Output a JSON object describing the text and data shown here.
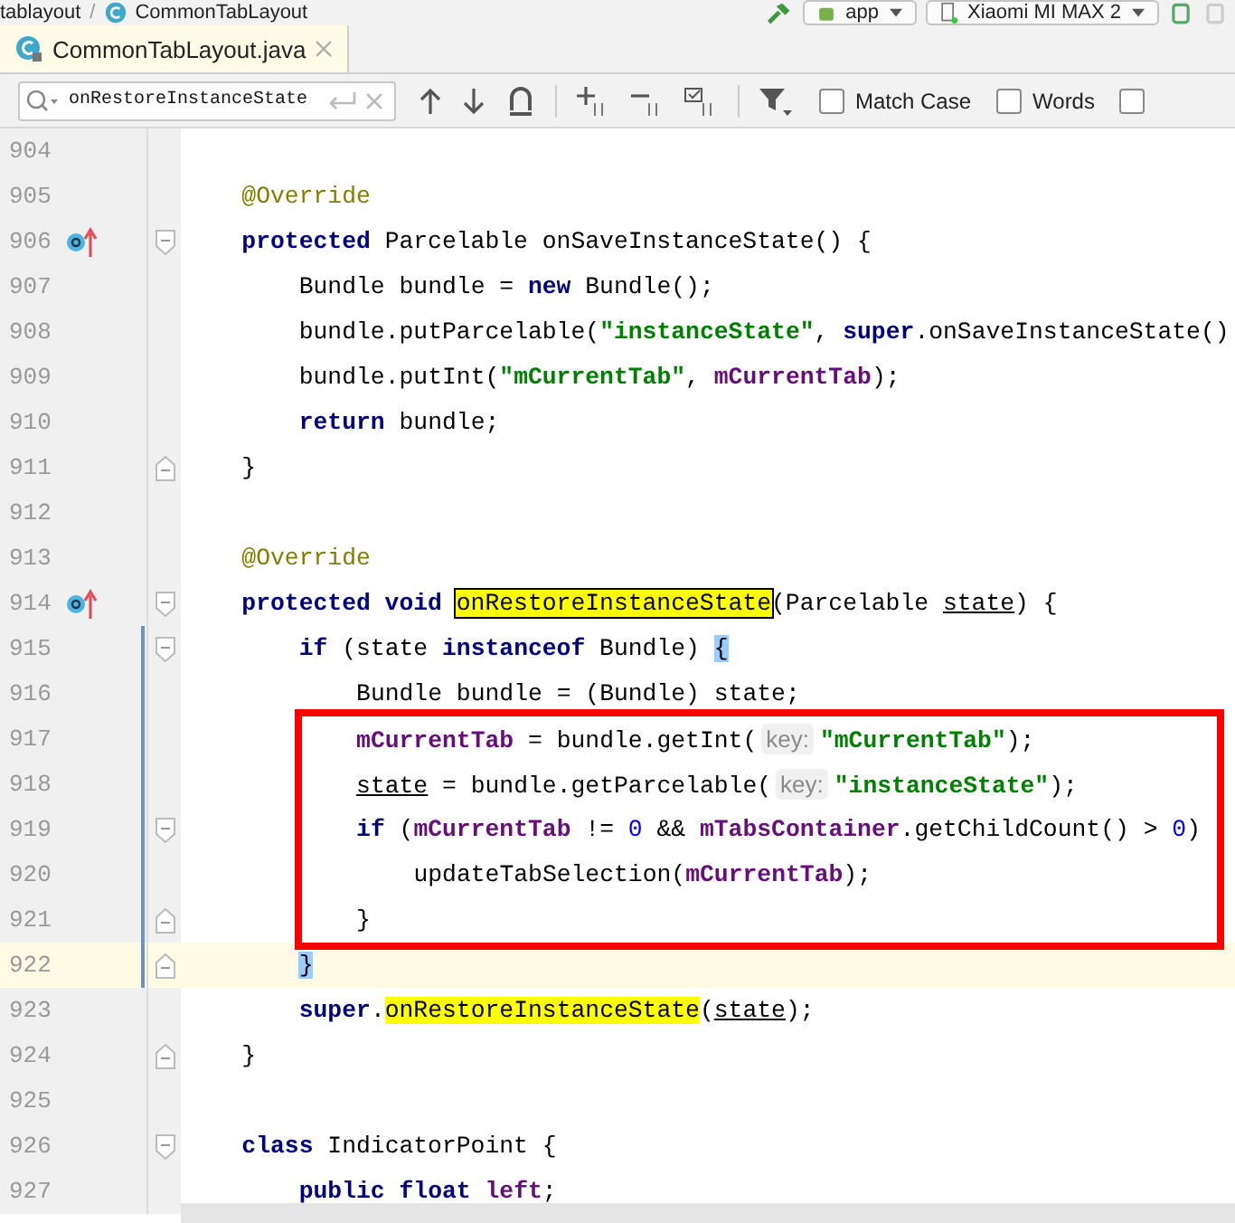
{
  "breadcrumbs": [
    {
      "label": "tablayout"
    },
    {
      "label": "CommonTabLayout"
    }
  ],
  "breadcrumb_separator": "/",
  "toolbar": {
    "run_config": "app",
    "device": "Xiaomi MI MAX 2"
  },
  "tabs": [
    {
      "label": "CommonTabLayout.java",
      "selected": true
    }
  ],
  "search": {
    "value": "onRestoreInstanceState",
    "options": [
      {
        "label": "Match Case",
        "checked": false
      },
      {
        "label": "Words",
        "checked": false
      },
      {
        "checked": false
      }
    ]
  },
  "lines": [
    {
      "number": "904",
      "override": false,
      "changed": false,
      "current": false,
      "boxed": false,
      "fold_start": false,
      "fold_end": false
    },
    {
      "number": "905",
      "override": false,
      "changed": false,
      "current": false,
      "boxed": false,
      "fold_start": false,
      "fold_end": false,
      "tokens": [
        {
          "kind": "ann",
          "text": "@Override"
        }
      ]
    },
    {
      "number": "906",
      "override": true,
      "changed": false,
      "current": false,
      "boxed": false,
      "fold_start": true,
      "fold_end": false,
      "tokens": [
        {
          "kind": "kw",
          "text": "protected"
        },
        {
          "kind": "plain",
          "text": " Parcelable onSaveInstanceState() {"
        }
      ],
      "children": [
        {
          "number": "907",
          "override": false,
          "changed": false,
          "current": false,
          "boxed": false,
          "fold_start": false,
          "fold_end": false,
          "tokens": [
            {
              "kind": "plain",
              "text": "Bundle bundle = "
            },
            {
              "kind": "kw",
              "text": "new"
            },
            {
              "kind": "plain",
              "text": " Bundle();"
            }
          ]
        },
        {
          "number": "908",
          "override": false,
          "changed": false,
          "current": false,
          "boxed": false,
          "fold_start": false,
          "fold_end": false,
          "tokens": [
            {
              "kind": "plain",
              "text": "bundle.putParcelable("
            },
            {
              "kind": "str",
              "text": "\"instanceState\""
            },
            {
              "kind": "plain",
              "text": ", "
            },
            {
              "kind": "kw",
              "text": "super"
            },
            {
              "kind": "plain",
              "text": ".onSaveInstanceState()"
            }
          ]
        },
        {
          "number": "909",
          "override": false,
          "changed": false,
          "current": false,
          "boxed": false,
          "fold_start": false,
          "fold_end": false,
          "tokens": [
            {
              "kind": "plain",
              "text": "bundle.putInt("
            },
            {
              "kind": "str",
              "text": "\"mCurrentTab\""
            },
            {
              "kind": "plain",
              "text": ", "
            },
            {
              "kind": "field",
              "text": "mCurrentTab"
            },
            {
              "kind": "plain",
              "text": ");"
            }
          ]
        },
        {
          "number": "910",
          "override": false,
          "changed": false,
          "current": false,
          "boxed": false,
          "fold_start": false,
          "fold_end": false,
          "tokens": [
            {
              "kind": "kw",
              "text": "return"
            },
            {
              "kind": "plain",
              "text": " bundle;"
            }
          ]
        }
      ]
    },
    {
      "number": "911",
      "override": false,
      "changed": false,
      "current": false,
      "boxed": false,
      "fold_start": false,
      "fold_end": true,
      "tokens": [
        {
          "kind": "plain",
          "text": "}"
        }
      ]
    },
    {
      "number": "912",
      "override": false,
      "changed": false,
      "current": false,
      "boxed": false,
      "fold_start": false,
      "fold_end": false
    },
    {
      "number": "913",
      "override": false,
      "changed": false,
      "current": false,
      "boxed": false,
      "fold_start": false,
      "fold_end": false,
      "tokens": [
        {
          "kind": "ann",
          "text": "@Override"
        }
      ]
    },
    {
      "number": "914",
      "override": true,
      "changed": false,
      "current": false,
      "boxed": false,
      "fold_start": true,
      "fold_end": false,
      "tokens": [
        {
          "kind": "kw",
          "text": "protected void "
        },
        {
          "kind": "match-current",
          "text": "onRestoreInstanceState"
        },
        {
          "kind": "plain",
          "text": "(Parcelable "
        },
        {
          "kind": "param",
          "text": "state"
        },
        {
          "kind": "plain",
          "text": ") {"
        }
      ],
      "children": [
        {
          "number": "915",
          "override": false,
          "changed": true,
          "current": false,
          "boxed": false,
          "fold_start": true,
          "fold_end": false,
          "tokens": [
            {
              "kind": "kw",
              "text": "if"
            },
            {
              "kind": "plain",
              "text": " (state "
            },
            {
              "kind": "kw",
              "text": "instanceof"
            },
            {
              "kind": "plain",
              "text": " Bundle) "
            },
            {
              "kind": "brace",
              "text": "{"
            }
          ],
          "children": [
            {
              "number": "916",
              "override": false,
              "changed": true,
              "current": false,
              "boxed": false,
              "fold_start": false,
              "fold_end": false,
              "tokens": [
                {
                  "kind": "plain",
                  "text": "Bundle bundle = (Bundle) state;"
                }
              ]
            },
            {
              "number": "917",
              "override": false,
              "changed": true,
              "current": false,
              "boxed": true,
              "fold_start": false,
              "fold_end": false,
              "tokens": [
                {
                  "kind": "field",
                  "text": "mCurrentTab"
                },
                {
                  "kind": "plain",
                  "text": " = bundle.getInt("
                },
                {
                  "kind": "hint",
                  "text": "key:"
                },
                {
                  "kind": "str",
                  "text": "\"mCurrentTab\""
                },
                {
                  "kind": "plain",
                  "text": ");"
                }
              ]
            },
            {
              "number": "918",
              "override": false,
              "changed": true,
              "current": false,
              "boxed": true,
              "fold_start": false,
              "fold_end": false,
              "tokens": [
                {
                  "kind": "param",
                  "text": "state"
                },
                {
                  "kind": "plain",
                  "text": " = bundle.getParcelable("
                },
                {
                  "kind": "hint",
                  "text": "key:"
                },
                {
                  "kind": "str",
                  "text": "\"instanceState\""
                },
                {
                  "kind": "plain",
                  "text": ");"
                }
              ]
            },
            {
              "number": "919",
              "override": false,
              "changed": true,
              "current": false,
              "boxed": true,
              "fold_start": true,
              "fold_end": false,
              "tokens": [
                {
                  "kind": "kw",
                  "text": "if"
                },
                {
                  "kind": "plain",
                  "text": " ("
                },
                {
                  "kind": "field",
                  "text": "mCurrentTab"
                },
                {
                  "kind": "plain",
                  "text": " != "
                },
                {
                  "kind": "num",
                  "text": "0"
                },
                {
                  "kind": "plain",
                  "text": " && "
                },
                {
                  "kind": "field",
                  "text": "mTabsContainer"
                },
                {
                  "kind": "plain",
                  "text": ".getChildCount() > "
                },
                {
                  "kind": "num",
                  "text": "0"
                },
                {
                  "kind": "plain",
                  "text": ")"
                }
              ],
              "children": [
                {
                  "number": "920",
                  "override": false,
                  "changed": true,
                  "current": false,
                  "boxed": true,
                  "fold_start": false,
                  "fold_end": false,
                  "tokens": [
                    {
                      "kind": "plain",
                      "text": "updateTabSelection("
                    },
                    {
                      "kind": "field",
                      "text": "mCurrentTab"
                    },
                    {
                      "kind": "plain",
                      "text": ");"
                    }
                  ]
                }
              ]
            },
            {
              "number": "921",
              "override": false,
              "changed": true,
              "current": false,
              "boxed": true,
              "fold_start": false,
              "fold_end": true,
              "tokens": [
                {
                  "kind": "plain",
                  "text": "}"
                }
              ]
            }
          ]
        },
        {
          "number": "922",
          "override": false,
          "changed": true,
          "current": true,
          "boxed": false,
          "fold_start": false,
          "fold_end": true,
          "tokens": [
            {
              "kind": "brace",
              "text": "}"
            }
          ]
        },
        {
          "number": "923",
          "override": false,
          "changed": false,
          "current": false,
          "boxed": false,
          "fold_start": false,
          "fold_end": false,
          "tokens": [
            {
              "kind": "kw",
              "text": "super"
            },
            {
              "kind": "plain",
              "text": "."
            },
            {
              "kind": "match",
              "text": "onRestoreInstanceState"
            },
            {
              "kind": "plain",
              "text": "("
            },
            {
              "kind": "param",
              "text": "state"
            },
            {
              "kind": "plain",
              "text": ");"
            }
          ]
        }
      ]
    },
    {
      "number": "924",
      "override": false,
      "changed": false,
      "current": false,
      "boxed": false,
      "fold_start": false,
      "fold_end": true,
      "tokens": [
        {
          "kind": "plain",
          "text": "}"
        }
      ]
    },
    {
      "number": "925",
      "override": false,
      "changed": false,
      "current": false,
      "boxed": false,
      "fold_start": false,
      "fold_end": false
    },
    {
      "number": "926",
      "override": false,
      "changed": false,
      "current": false,
      "boxed": false,
      "fold_start": true,
      "fold_end": false,
      "tokens": [
        {
          "kind": "kw",
          "text": "class"
        },
        {
          "kind": "plain",
          "text": " IndicatorPoint {"
        }
      ],
      "children": [
        {
          "number": "927",
          "override": false,
          "changed": false,
          "current": false,
          "boxed": false,
          "fold_start": false,
          "fold_end": false,
          "tokens": [
            {
              "kind": "kw",
              "text": "public float "
            },
            {
              "kind": "field",
              "text": "left"
            },
            {
              "kind": "plain",
              "text": ";"
            }
          ]
        }
      ]
    }
  ]
}
